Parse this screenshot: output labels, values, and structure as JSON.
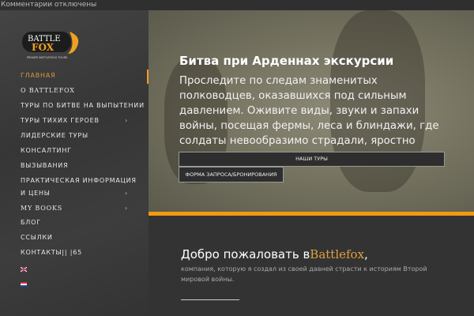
{
  "topbar": {
    "text": "Комментарии отключены"
  },
  "logo": {
    "line1": "BATTLE",
    "line2": "FOX",
    "tagline": "PRIVATE BATTLEFIELD TOURS"
  },
  "nav": [
    {
      "label": "ГЛАВНАЯ",
      "active": true
    },
    {
      "label": "О BATTLEFOX"
    },
    {
      "label": "ТУРЫ ПО БИТВЕ НА ВЫПЫТЕНИИ"
    },
    {
      "label": "ТУРЫ ТИХИХ ГЕРОЕВ",
      "submenu": true
    },
    {
      "label": "ЛИДЕРСКИЕ ТУРЫ"
    },
    {
      "label": "КОНСАЛТИНГ"
    },
    {
      "label": "ВЫЗЫВАНИЯ"
    },
    {
      "label": "ПРАКТИЧЕСКАЯ ИНФОРМАЦИЯ"
    },
    {
      "label": "И ЦЕНЫ",
      "submenu": true
    },
    {
      "label": "MY BOOKS",
      "submenu": true
    },
    {
      "label": "БЛОГ"
    },
    {
      "label": "ССЫЛКИ"
    },
    {
      "label": "КОНТАКТЫ|| |65"
    }
  ],
  "chevron": "›",
  "hero": {
    "title": "Битва при Арденнах экскурсии",
    "text": "Проследите по следам знаменитых полководцев, оказавшихся под сильным давлением. Оживите виды, звуки и запахи войны, посещая фермы, леса и блиндажи, где солдаты невообразимо страдали, яростно сражались и заслужили высшие награды за храбрость.",
    "btn_tours": "НАШИ ТУРЫ",
    "btn_form": "ФОРМА ЗАПРОСА/БРОНИРОВАНИЯ"
  },
  "welcome": {
    "prefix": "Добро пожаловать в",
    "brand": "Battlefox",
    "suffix": ",",
    "subtitle": "компания, которую я создал из своей давней страсти к историям Второй мировой войны."
  },
  "colors": {
    "accent": "#f29a12",
    "active": "#d59a3c"
  }
}
